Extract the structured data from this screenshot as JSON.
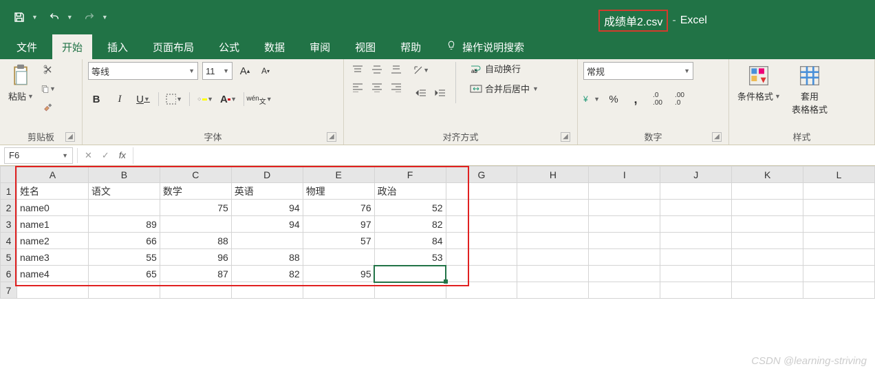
{
  "title": {
    "filename": "成绩单2.csv",
    "sep": "-",
    "app": "Excel"
  },
  "tabs": {
    "file": "文件",
    "home": "开始",
    "insert": "插入",
    "layout": "页面布局",
    "formulas": "公式",
    "data": "数据",
    "review": "审阅",
    "view": "视图",
    "help": "帮助",
    "tell_me": "操作说明搜索"
  },
  "ribbon": {
    "clipboard": {
      "paste": "粘贴",
      "label": "剪贴板"
    },
    "font": {
      "name": "等线",
      "size": "11",
      "label": "字体",
      "bold": "B",
      "italic": "I",
      "underline": "U",
      "wen": "wén"
    },
    "alignment": {
      "wrap": "自动换行",
      "merge": "合并后居中",
      "label": "对齐方式"
    },
    "number": {
      "format": "常规",
      "percent": "%",
      "comma": ",",
      "label": "数字"
    },
    "styles": {
      "cond": "条件格式",
      "table": "套用\n表格格式",
      "label": "样式"
    }
  },
  "formula_bar": {
    "name_box": "F6",
    "fx": "fx"
  },
  "grid": {
    "columns": [
      "A",
      "B",
      "C",
      "D",
      "E",
      "F",
      "G",
      "H",
      "I",
      "J",
      "K",
      "L"
    ],
    "rows": [
      "1",
      "2",
      "3",
      "4",
      "5",
      "6",
      "7"
    ],
    "headers": [
      "姓名",
      "语文",
      "数学",
      "英语",
      "物理",
      "政治"
    ],
    "data": [
      [
        "name0",
        "",
        "75",
        "94",
        "76",
        "52"
      ],
      [
        "name1",
        "89",
        "",
        "94",
        "97",
        "82"
      ],
      [
        "name2",
        "66",
        "88",
        "",
        "57",
        "84"
      ],
      [
        "name3",
        "55",
        "96",
        "88",
        "",
        "53"
      ],
      [
        "name4",
        "65",
        "87",
        "82",
        "95",
        ""
      ]
    ],
    "active": "F6"
  },
  "watermark": "CSDN @learning-striving",
  "chart_data": {
    "type": "table",
    "title": "成绩单2.csv",
    "columns": [
      "姓名",
      "语文",
      "数学",
      "英语",
      "物理",
      "政治"
    ],
    "rows": [
      {
        "姓名": "name0",
        "语文": null,
        "数学": 75,
        "英语": 94,
        "物理": 76,
        "政治": 52
      },
      {
        "姓名": "name1",
        "语文": 89,
        "数学": null,
        "英语": 94,
        "物理": 97,
        "政治": 82
      },
      {
        "姓名": "name2",
        "语文": 66,
        "数学": 88,
        "英语": null,
        "物理": 57,
        "政治": 84
      },
      {
        "姓名": "name3",
        "语文": 55,
        "数学": 96,
        "英语": 88,
        "物理": null,
        "政治": 53
      },
      {
        "姓名": "name4",
        "语文": 65,
        "数学": 87,
        "英语": 82,
        "物理": 95,
        "政治": null
      }
    ]
  }
}
